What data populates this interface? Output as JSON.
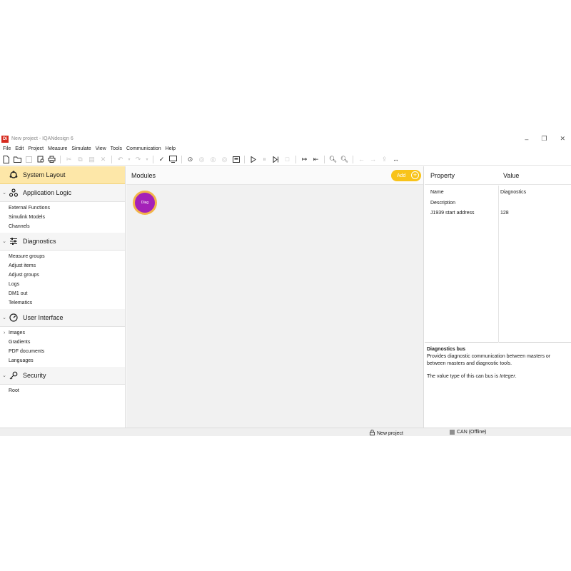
{
  "window": {
    "logo_text": "Di",
    "title": "New project - IQANdesign 6",
    "controls": [
      "–",
      "❐",
      "✕"
    ]
  },
  "menu": [
    "File",
    "Edit",
    "Project",
    "Measure",
    "Simulate",
    "View",
    "Tools",
    "Communication",
    "Help"
  ],
  "sidebar": {
    "sections": [
      {
        "label": "System Layout",
        "active": true,
        "icon": "system-layout-icon",
        "items": []
      },
      {
        "label": "Application Logic",
        "icon": "application-logic-icon",
        "items": [
          "External Functions",
          "Simulink Models",
          "Channels"
        ]
      },
      {
        "label": "Diagnostics",
        "icon": "sliders-icon",
        "items": [
          "Measure groups",
          "Adjust items",
          "Adjust groups",
          "Logs",
          "DM1 out",
          "Telematics"
        ]
      },
      {
        "label": "User Interface",
        "icon": "gauge-icon",
        "items": [
          "Images",
          "Gradients",
          "PDF documents",
          "Languages"
        ]
      },
      {
        "label": "Security",
        "icon": "key-icon",
        "items": [
          "Root"
        ]
      }
    ]
  },
  "canvas": {
    "title": "Modules",
    "add_label": "Add",
    "module_label": "Diag"
  },
  "properties": {
    "col_property": "Property",
    "col_value": "Value",
    "rows": [
      {
        "key": "Name",
        "value": "Diagnostics"
      },
      {
        "key": "Description",
        "value": ""
      },
      {
        "key": "J1939 start address",
        "value": "128"
      }
    ],
    "desc_title": "Diagnostics bus",
    "desc_text": "Provides diagnostic communication between masters or between masters and diagnostic tools.",
    "desc_text2_prefix": "The value type of this can bus is ",
    "desc_text2_em": "Integer",
    "desc_text2_suffix": "."
  },
  "status": {
    "project": "New project",
    "can": "CAN (Offline)"
  }
}
